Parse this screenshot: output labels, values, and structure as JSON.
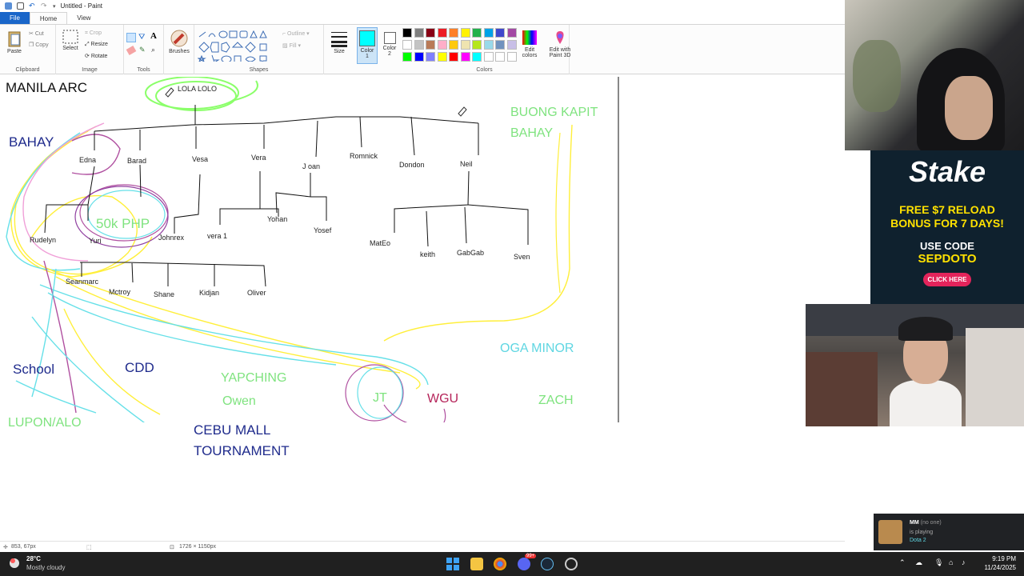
{
  "window": {
    "title": "Untitled - Paint"
  },
  "tabs": [
    {
      "label": "File"
    },
    {
      "label": "Home"
    },
    {
      "label": "View"
    }
  ],
  "ribbon": {
    "clipboard": {
      "paste": "Paste",
      "cut": "Cut",
      "copy": "Copy",
      "label": "Clipboard"
    },
    "image": {
      "select": "Select",
      "crop": "Crop",
      "resize": "Resize",
      "rotate": "Rotate",
      "label": "Image"
    },
    "tools": {
      "label": "Tools"
    },
    "brushes": {
      "label": "Brushes"
    },
    "shapes": {
      "outline": "Outline",
      "fill": "Fill",
      "label": "Shapes"
    },
    "size": {
      "label": "Size"
    },
    "color1": {
      "label1": "Color",
      "label2": "1"
    },
    "color2": {
      "label1": "Color",
      "label2": "2"
    },
    "colors": {
      "label": "Colors",
      "edit1": "Edit",
      "edit2": "colors"
    },
    "paint3d": {
      "line1": "Edit with",
      "line2": "Paint 3D"
    },
    "palette_row1": [
      "#000000",
      "#7f7f7f",
      "#880015",
      "#ed1c24",
      "#ff7f27",
      "#fff200",
      "#22b14c",
      "#00a2e8",
      "#3f48cc",
      "#a349a4"
    ],
    "palette_row2": [
      "#ffffff",
      "#c3c3c3",
      "#b97a57",
      "#ffaec9",
      "#ffc90e",
      "#efe4b0",
      "#b5e61d",
      "#99d9ea",
      "#7092be",
      "#c8bfe7"
    ],
    "palette_row3": [
      "#00ff00",
      "#0000ff",
      "#8080ff",
      "#ffff00",
      "#ff0000",
      "#ff00ff",
      "#00ffff",
      "#ffffff",
      "#ffffff",
      "#ffffff"
    ],
    "active_color": "#00ffff"
  },
  "drawing": {
    "labels": {
      "manila_arc": "MANILA ARC",
      "lola_lolo": "LOLA LOLO",
      "bahay": "BAHAY",
      "buong_kapit": "BUONG KAPIT",
      "bahay2": "BAHAY",
      "php": "50k PHP",
      "school": "School",
      "cdd": "CDD",
      "lupon": "LUPON/ALO",
      "yapching": "YAPCHING",
      "owen": "Owen",
      "cebu1": "CEBU MALL",
      "cebu2": "TOURNAMENT",
      "jt": "JT",
      "wgu": "WGU",
      "oga": "OGA MINOR",
      "zach": "ZACH"
    },
    "names": {
      "edna": "Edna",
      "barad": "Barad",
      "vesa": "Vesa",
      "vera": "Vera",
      "joan": "J oan",
      "romnick": "Romnick",
      "dondon": "Dondon",
      "neil": "Neil",
      "rudelyn": "Rudelyn",
      "yuri": "Yuri",
      "johnrex": "Johnrex",
      "vera1": "vera 1",
      "yohan": "Yohan",
      "yosef": "Yosef",
      "mateo": "MatEo",
      "keith": "keith",
      "gabgab": "GabGab",
      "sven": "Sven",
      "seanmarc": "Seanmarc",
      "mctroy": "Mctroy",
      "shane": "Shane",
      "kidjan": "Kidjan",
      "oliver": "Oliver"
    }
  },
  "statusbar": {
    "coords": "853, 67px",
    "size": "1726 × 1150px"
  },
  "stake": {
    "logo": "Stake",
    "line1": "FREE $7 RELOAD",
    "line2": "BONUS FOR 7 DAYS!",
    "line3": "USE CODE",
    "code": "SEPDOTO",
    "cta": "CLICK HERE"
  },
  "discord": {
    "name": "MM",
    "status": "(no one)",
    "line2": "is playing",
    "game": "Dota 2"
  },
  "taskbar": {
    "temp": "28°C",
    "weather": "Mostly cloudy",
    "time": "9:19 PM",
    "date": "11/24/2025",
    "badge": "99+"
  }
}
